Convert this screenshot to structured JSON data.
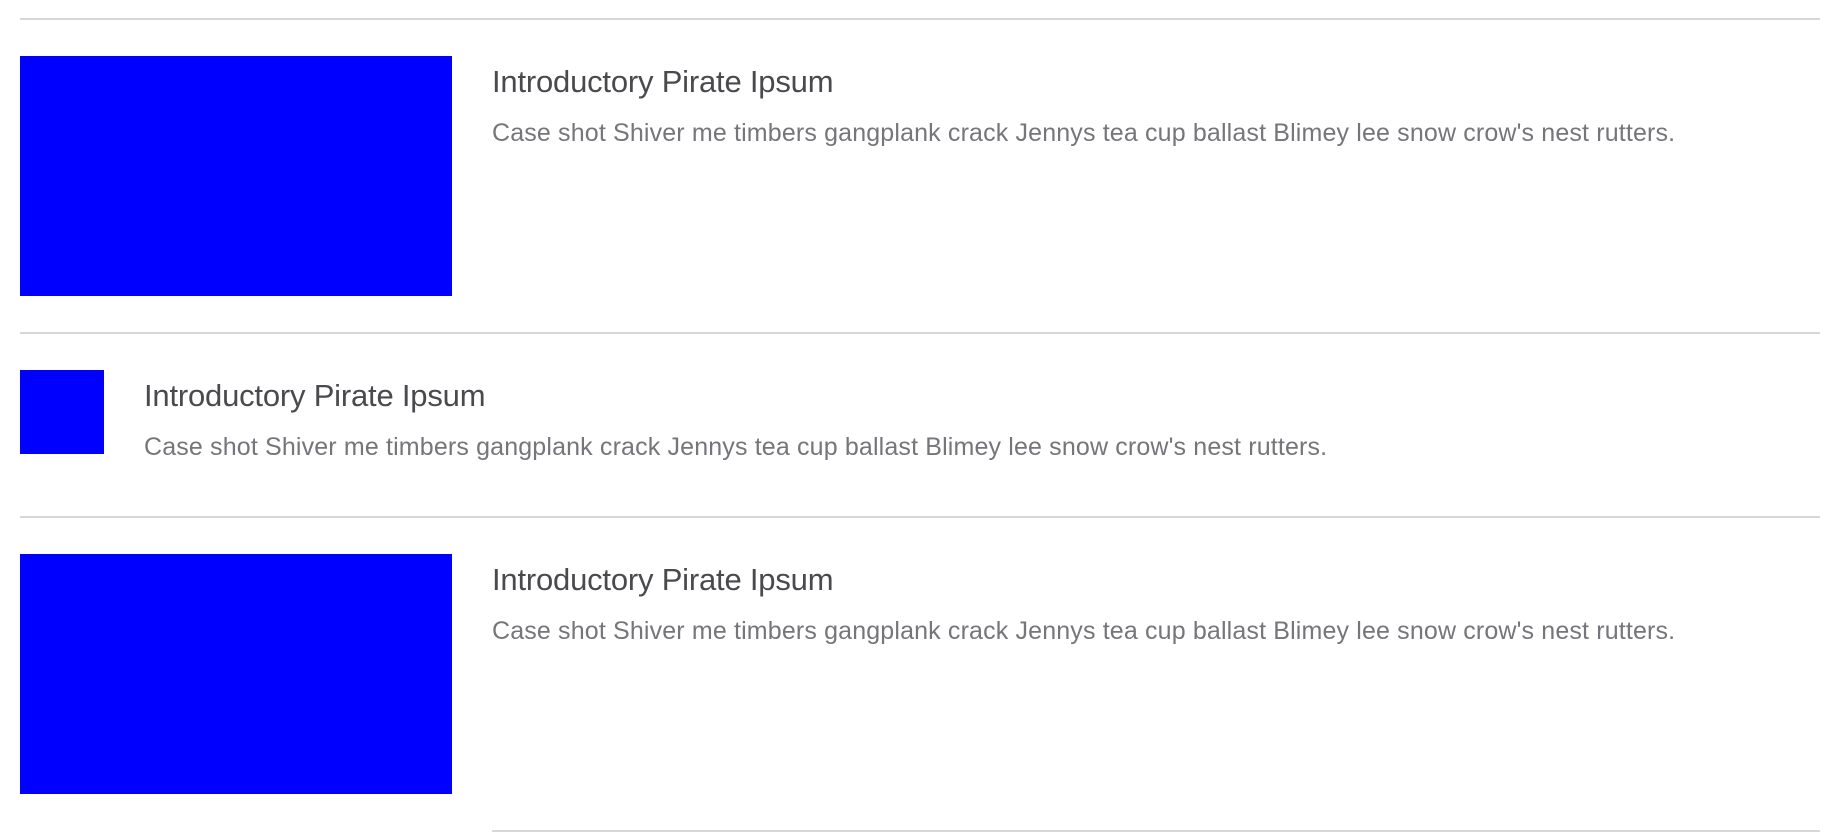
{
  "colors": {
    "thumbnail": "#0000ff",
    "divider": "#d7d7d9",
    "title": "#4a4a4e",
    "description": "#75757a"
  },
  "items": [
    {
      "variant": "large",
      "title": "Introductory Pirate Ipsum",
      "description": "Case shot Shiver me timbers gangplank crack Jennys tea cup ballast Blimey lee snow crow's nest rutters."
    },
    {
      "variant": "small",
      "title": "Introductory Pirate Ipsum",
      "description": "Case shot Shiver me timbers gangplank crack Jennys tea cup ballast Blimey lee snow crow's nest rutters."
    },
    {
      "variant": "large",
      "title": "Introductory Pirate Ipsum",
      "description": "Case shot Shiver me timbers gangplank crack Jennys tea cup ballast Blimey lee snow crow's nest rutters."
    }
  ]
}
